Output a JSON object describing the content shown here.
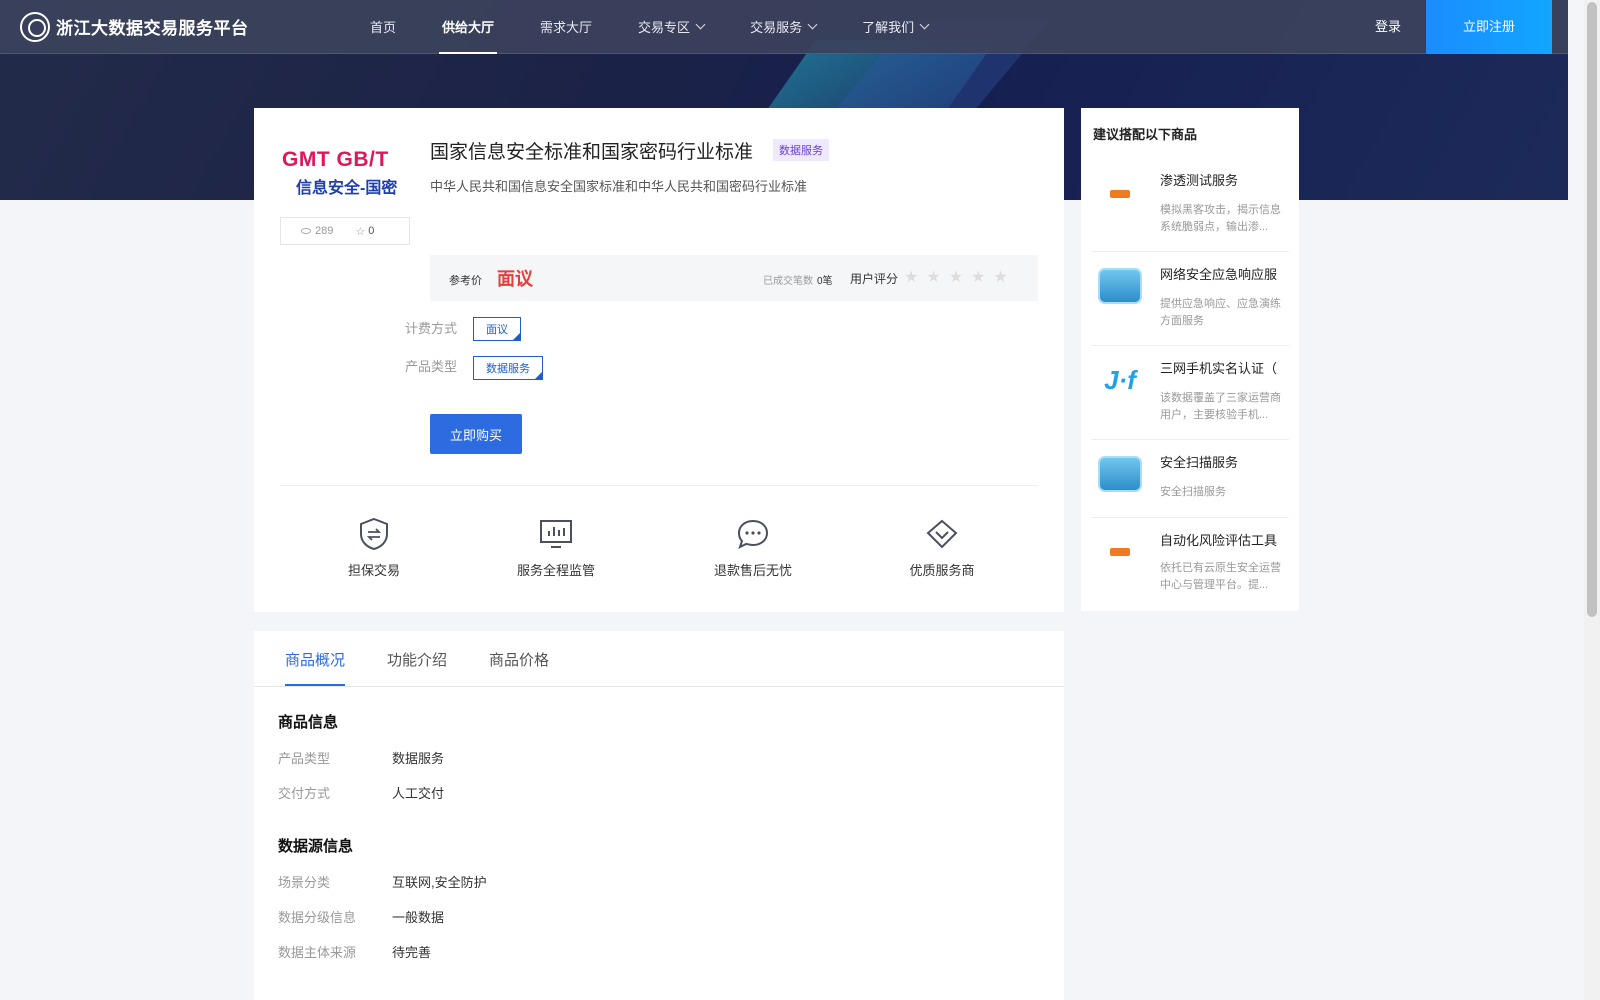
{
  "header": {
    "brand": "浙江大数据交易服务平台",
    "nav": [
      {
        "label": "首页",
        "dropdown": false,
        "active": false
      },
      {
        "label": "供给大厅",
        "dropdown": false,
        "active": true
      },
      {
        "label": "需求大厅",
        "dropdown": false,
        "active": false
      },
      {
        "label": "交易专区",
        "dropdown": true,
        "active": false
      },
      {
        "label": "交易服务",
        "dropdown": true,
        "active": false
      },
      {
        "label": "了解我们",
        "dropdown": true,
        "active": false
      }
    ],
    "login": "登录",
    "register": "立即注册"
  },
  "product": {
    "logo_line1": "GMT   GB/T",
    "logo_line2": "信息安全-国密",
    "views": "289",
    "favorites": "0",
    "title": "国家信息安全标准和国家密码行业标准",
    "badge": "数据服务",
    "subtitle": "中华人民共和国信息安全国家标准和中华人民共和国密码行业标准",
    "price_label": "参考价",
    "price_value": "面议",
    "deals_label": "已成交笔数",
    "deals_value": "0笔",
    "rating_label": "用户评分",
    "rating_stars": "★★★★★",
    "billing_label": "计费方式",
    "billing_value": "面议",
    "type_label": "产品类型",
    "type_value": "数据服务",
    "buy_button": "立即购买",
    "features": [
      "担保交易",
      "服务全程监管",
      "退款售后无忧",
      "优质服务商"
    ]
  },
  "sidebar": {
    "title": "建议搭配以下商品",
    "items": [
      {
        "name": "渗透测试服务",
        "desc": "模拟黑客攻击，揭示信息系统脆弱点，输出渗...",
        "thumb": "orange-logo"
      },
      {
        "name": "网络安全应急响应服",
        "desc": "提供应急响应、应急演练方面服务",
        "thumb": "cloud-badge"
      },
      {
        "name": "三网手机实名认证（",
        "desc": "该数据覆盖了三家运营商用户，主要核验手机...",
        "thumb": "jf-logo"
      },
      {
        "name": "安全扫描服务",
        "desc": "安全扫描服务",
        "thumb": "cloud-badge"
      },
      {
        "name": "自动化风险评估工具",
        "desc": "依托已有云原生安全运营中心与管理平台。提...",
        "thumb": "orange-logo"
      }
    ]
  },
  "tabs": [
    "商品概况",
    "功能介绍",
    "商品价格"
  ],
  "overview": {
    "product_info_title": "商品信息",
    "product_info": [
      {
        "k": "产品类型",
        "v": "数据服务"
      },
      {
        "k": "交付方式",
        "v": "人工交付"
      }
    ],
    "source_info_title": "数据源信息",
    "source_info": [
      {
        "k": "场景分类",
        "v": "互联网,安全防护"
      },
      {
        "k": "数据分级信息",
        "v": "一般数据"
      },
      {
        "k": "数据主体来源",
        "v": "待完善"
      }
    ]
  },
  "colors": {
    "accent": "#2c6be0",
    "price": "#e53e3e",
    "register": "#1a8cff"
  }
}
